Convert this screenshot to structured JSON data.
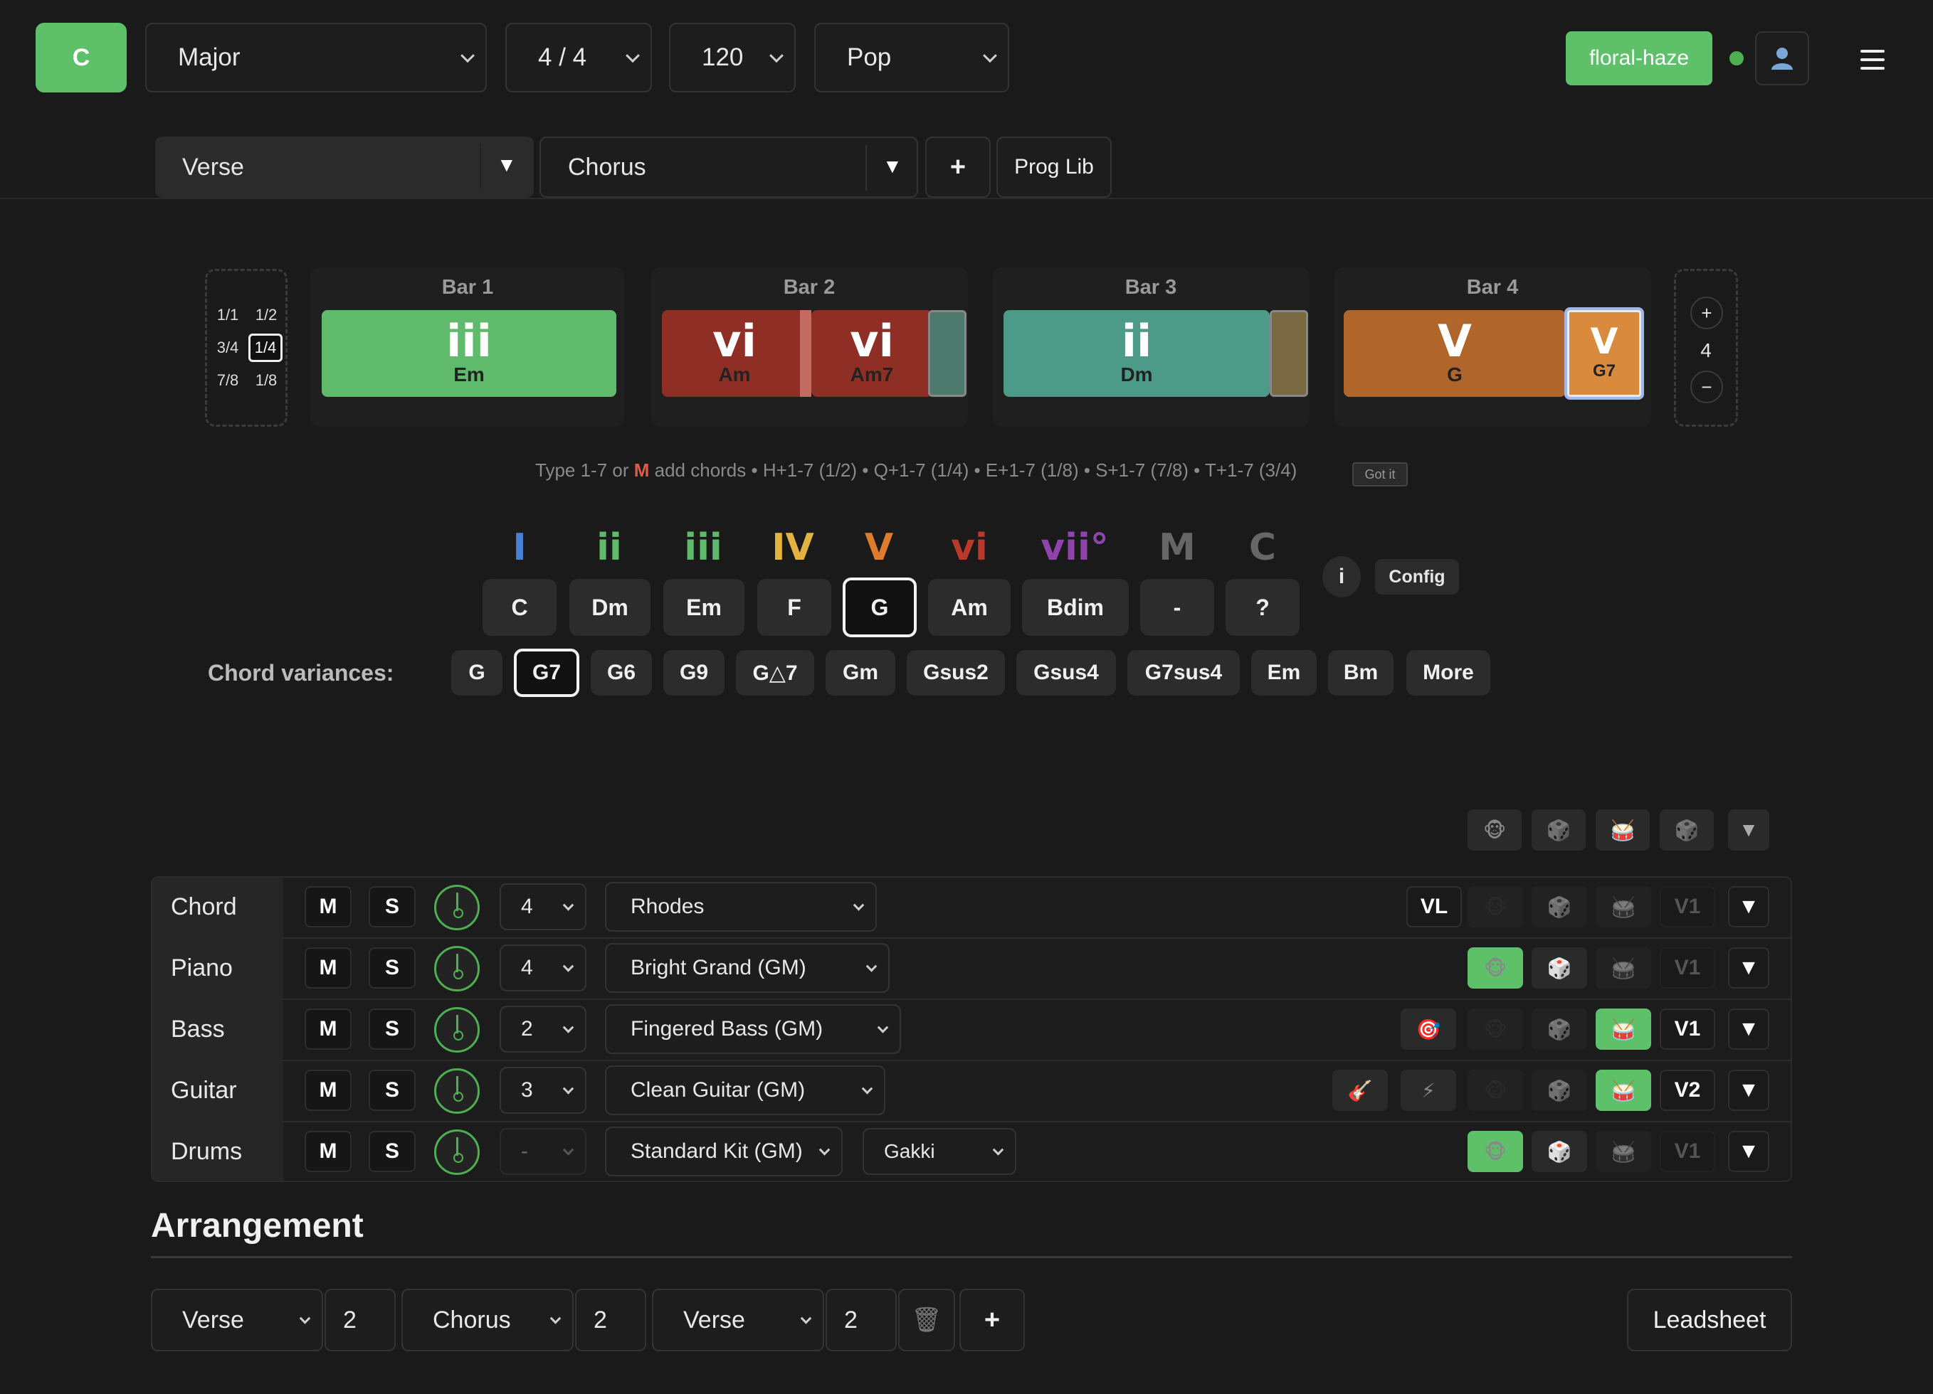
{
  "header": {
    "key": "C",
    "scale": "Major",
    "time_signature": "4 / 4",
    "tempo": "120",
    "style": "Pop",
    "user_name": "floral-haze",
    "user_icon": "user-icon",
    "menu_icon": "hamburger-menu-icon"
  },
  "sections": {
    "tabs": [
      "Verse",
      "Chorus"
    ],
    "add_label": "+",
    "prog_lib_label": "Prog Lib"
  },
  "durations": {
    "options": [
      "1/1",
      "1/2",
      "3/4",
      "1/4",
      "7/8",
      "1/8"
    ],
    "selected": "1/4"
  },
  "bars": [
    {
      "label": "Bar 1",
      "chords": [
        {
          "numeral": "iii",
          "name": "Em",
          "color": "#5fbb6b"
        }
      ]
    },
    {
      "label": "Bar 2",
      "chords": [
        {
          "numeral": "vi",
          "name": "Am",
          "color": "#8e2e25"
        },
        {
          "numeral": "vi",
          "name": "Am7",
          "color": "#8e2e25"
        }
      ]
    },
    {
      "label": "Bar 3",
      "chords": [
        {
          "numeral": "ii",
          "name": "Dm",
          "color": "#4e9a88"
        }
      ]
    },
    {
      "label": "Bar 4",
      "chords": [
        {
          "numeral": "V",
          "name": "G",
          "color": "#b0662a"
        },
        {
          "numeral": "V",
          "name": "G7",
          "color": "#d98a3c"
        }
      ]
    }
  ],
  "bar_count": {
    "plus": "+",
    "value": "4",
    "minus": "−"
  },
  "hint": {
    "prefix": "Type 1-7 or ",
    "m_key": "M",
    "suffix": " add chords • H+1-7 (1/2) • Q+1-7 (1/4) • E+1-7 (1/8) • S+1-7 (7/8) • T+1-7 (3/4)",
    "dismiss": "Got it"
  },
  "degrees": [
    {
      "numeral": "I",
      "chord": "C",
      "color": "#4a7fd6"
    },
    {
      "numeral": "ii",
      "chord": "Dm",
      "color": "#5fbb6b"
    },
    {
      "numeral": "iii",
      "chord": "Em",
      "color": "#5fbb6b"
    },
    {
      "numeral": "IV",
      "chord": "F",
      "color": "#e3b341"
    },
    {
      "numeral": "V",
      "chord": "G",
      "color": "#e07a2c"
    },
    {
      "numeral": "vi",
      "chord": "Am",
      "color": "#b93a2c"
    },
    {
      "numeral": "vii°",
      "chord": "Bdim",
      "color": "#8e44ad"
    },
    {
      "numeral": "M",
      "chord": "-",
      "color": "#666666"
    },
    {
      "numeral": "C",
      "chord": "?",
      "color": "#666666"
    }
  ],
  "degree_selected": "G",
  "info_label": "i",
  "config_label": "Config",
  "variances": {
    "label": "Chord variances:",
    "items": [
      "G",
      "G7",
      "G6",
      "G9",
      "G△7",
      "Gm",
      "Gsus2",
      "Gsus4",
      "G7sus4",
      "Em",
      "Bm",
      "More"
    ],
    "selected": "G7"
  },
  "global_icons": [
    "monkey-icon",
    "dice-icon",
    "drum-icon",
    "dice-icon",
    "chevron-down-icon"
  ],
  "tracks": [
    {
      "name": "Chord",
      "mute": "M",
      "solo": "S",
      "octave": "4",
      "instrument": "Rhodes",
      "extra": "VL",
      "voice": "V1"
    },
    {
      "name": "Piano",
      "mute": "M",
      "solo": "S",
      "octave": "4",
      "instrument": "Bright Grand (GM)",
      "voice": "V1"
    },
    {
      "name": "Bass",
      "mute": "M",
      "solo": "S",
      "octave": "2",
      "instrument": "Fingered Bass (GM)",
      "voice": "V1"
    },
    {
      "name": "Guitar",
      "mute": "M",
      "solo": "S",
      "octave": "3",
      "instrument": "Clean Guitar (GM)",
      "voice": "V2"
    },
    {
      "name": "Drums",
      "mute": "M",
      "solo": "S",
      "octave": "-",
      "instrument": "Standard Kit (GM)",
      "kit_style": "Gakki",
      "voice": "V1"
    }
  ],
  "arrangement": {
    "title": "Arrangement",
    "items": [
      {
        "section": "Verse",
        "repeat": "2"
      },
      {
        "section": "Chorus",
        "repeat": "2"
      },
      {
        "section": "Verse",
        "repeat": "2"
      }
    ],
    "add_label": "+",
    "leadsheet_label": "Leadsheet"
  },
  "colors": {
    "accent": "#5fc06a",
    "online": "#4caf50"
  }
}
